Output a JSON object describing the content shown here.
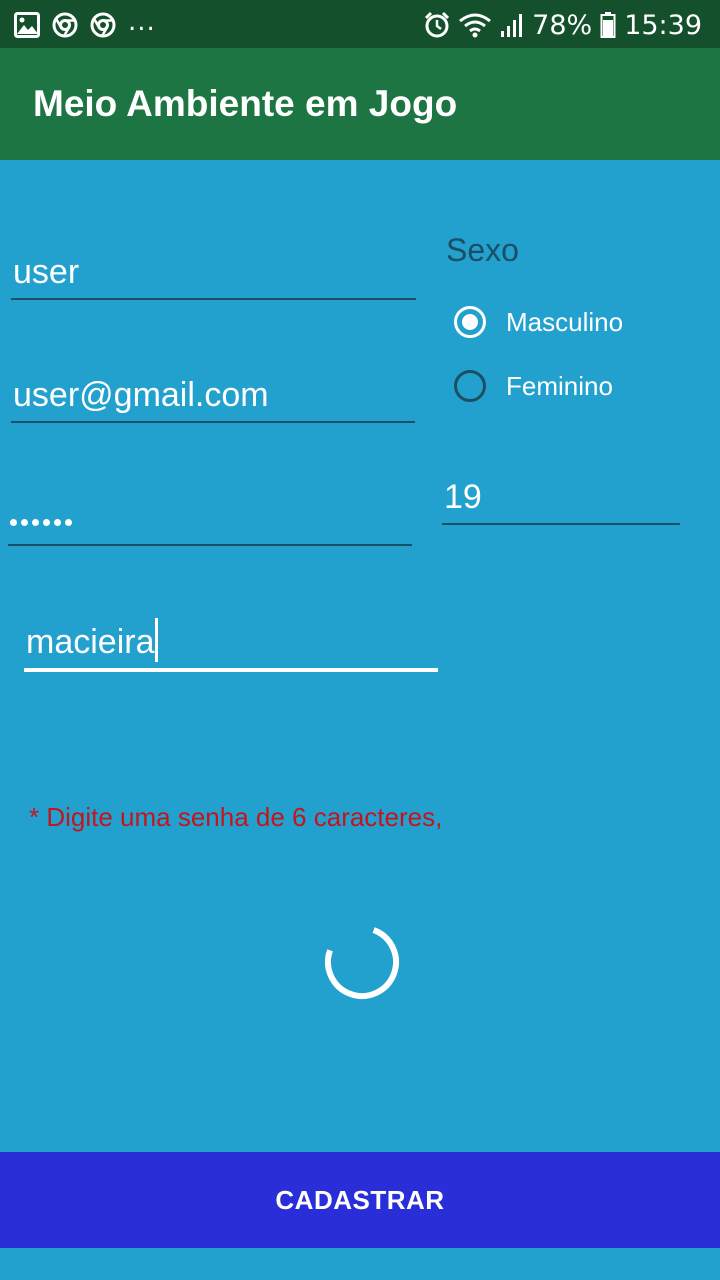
{
  "status_bar": {
    "left_icons": [
      "image-icon",
      "chrome-icon",
      "chrome-icon"
    ],
    "overflow": "...",
    "right_icons": [
      "alarm-icon",
      "wifi-icon",
      "signal-icon",
      "battery-icon"
    ],
    "battery_percent": "78%",
    "time": "15:39"
  },
  "app_bar": {
    "title": "Meio Ambiente em Jogo"
  },
  "form": {
    "username": "user",
    "email": "user@gmail.com",
    "password_masked_length": 6,
    "age": "19",
    "tree": "macieira",
    "sexo_label": "Sexo",
    "sexo_options": [
      {
        "label": "Masculino",
        "selected": true
      },
      {
        "label": "Feminino",
        "selected": false
      }
    ]
  },
  "error_message": "* Digite uma senha de 6 caracteres,",
  "submit_label": "CADASTRAR",
  "colors": {
    "status_bar": "#15502c",
    "app_bar": "#1c7542",
    "background": "#22a1cf",
    "underline": "#1a4f66",
    "error": "#c3151d",
    "button": "#2a2ed9"
  }
}
